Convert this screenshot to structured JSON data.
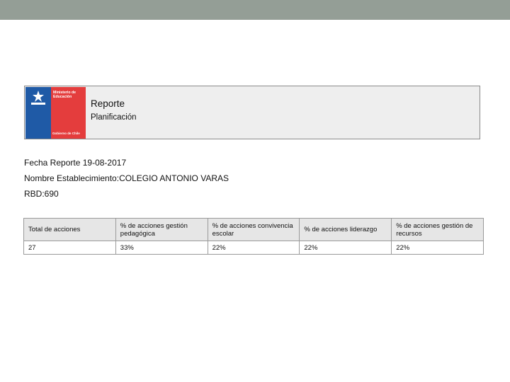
{
  "header": {
    "logo": {
      "ministry": "Ministerio de Educación",
      "government": "Gobierno de Chile",
      "colors": {
        "blue": "#1f5aa6",
        "red": "#e43d3d"
      }
    },
    "title": "Reporte",
    "subtitle": "Planificación"
  },
  "info": {
    "date_label": "Fecha Reporte",
    "date_value": "19-08-2017",
    "school_label": "Nombre Establecimiento:",
    "school_value": "COLEGIO ANTONIO VARAS",
    "rbd_label": "RBD:",
    "rbd_value": "690"
  },
  "table": {
    "headers": [
      "Total de acciones",
      "% de acciones gestión pedagógica",
      "% de acciones convivencia escolar",
      "% de acciones liderazgo",
      "% de acciones gestión de recursos"
    ],
    "row": [
      "27",
      "33%",
      "22%",
      "22%",
      "22%"
    ]
  }
}
